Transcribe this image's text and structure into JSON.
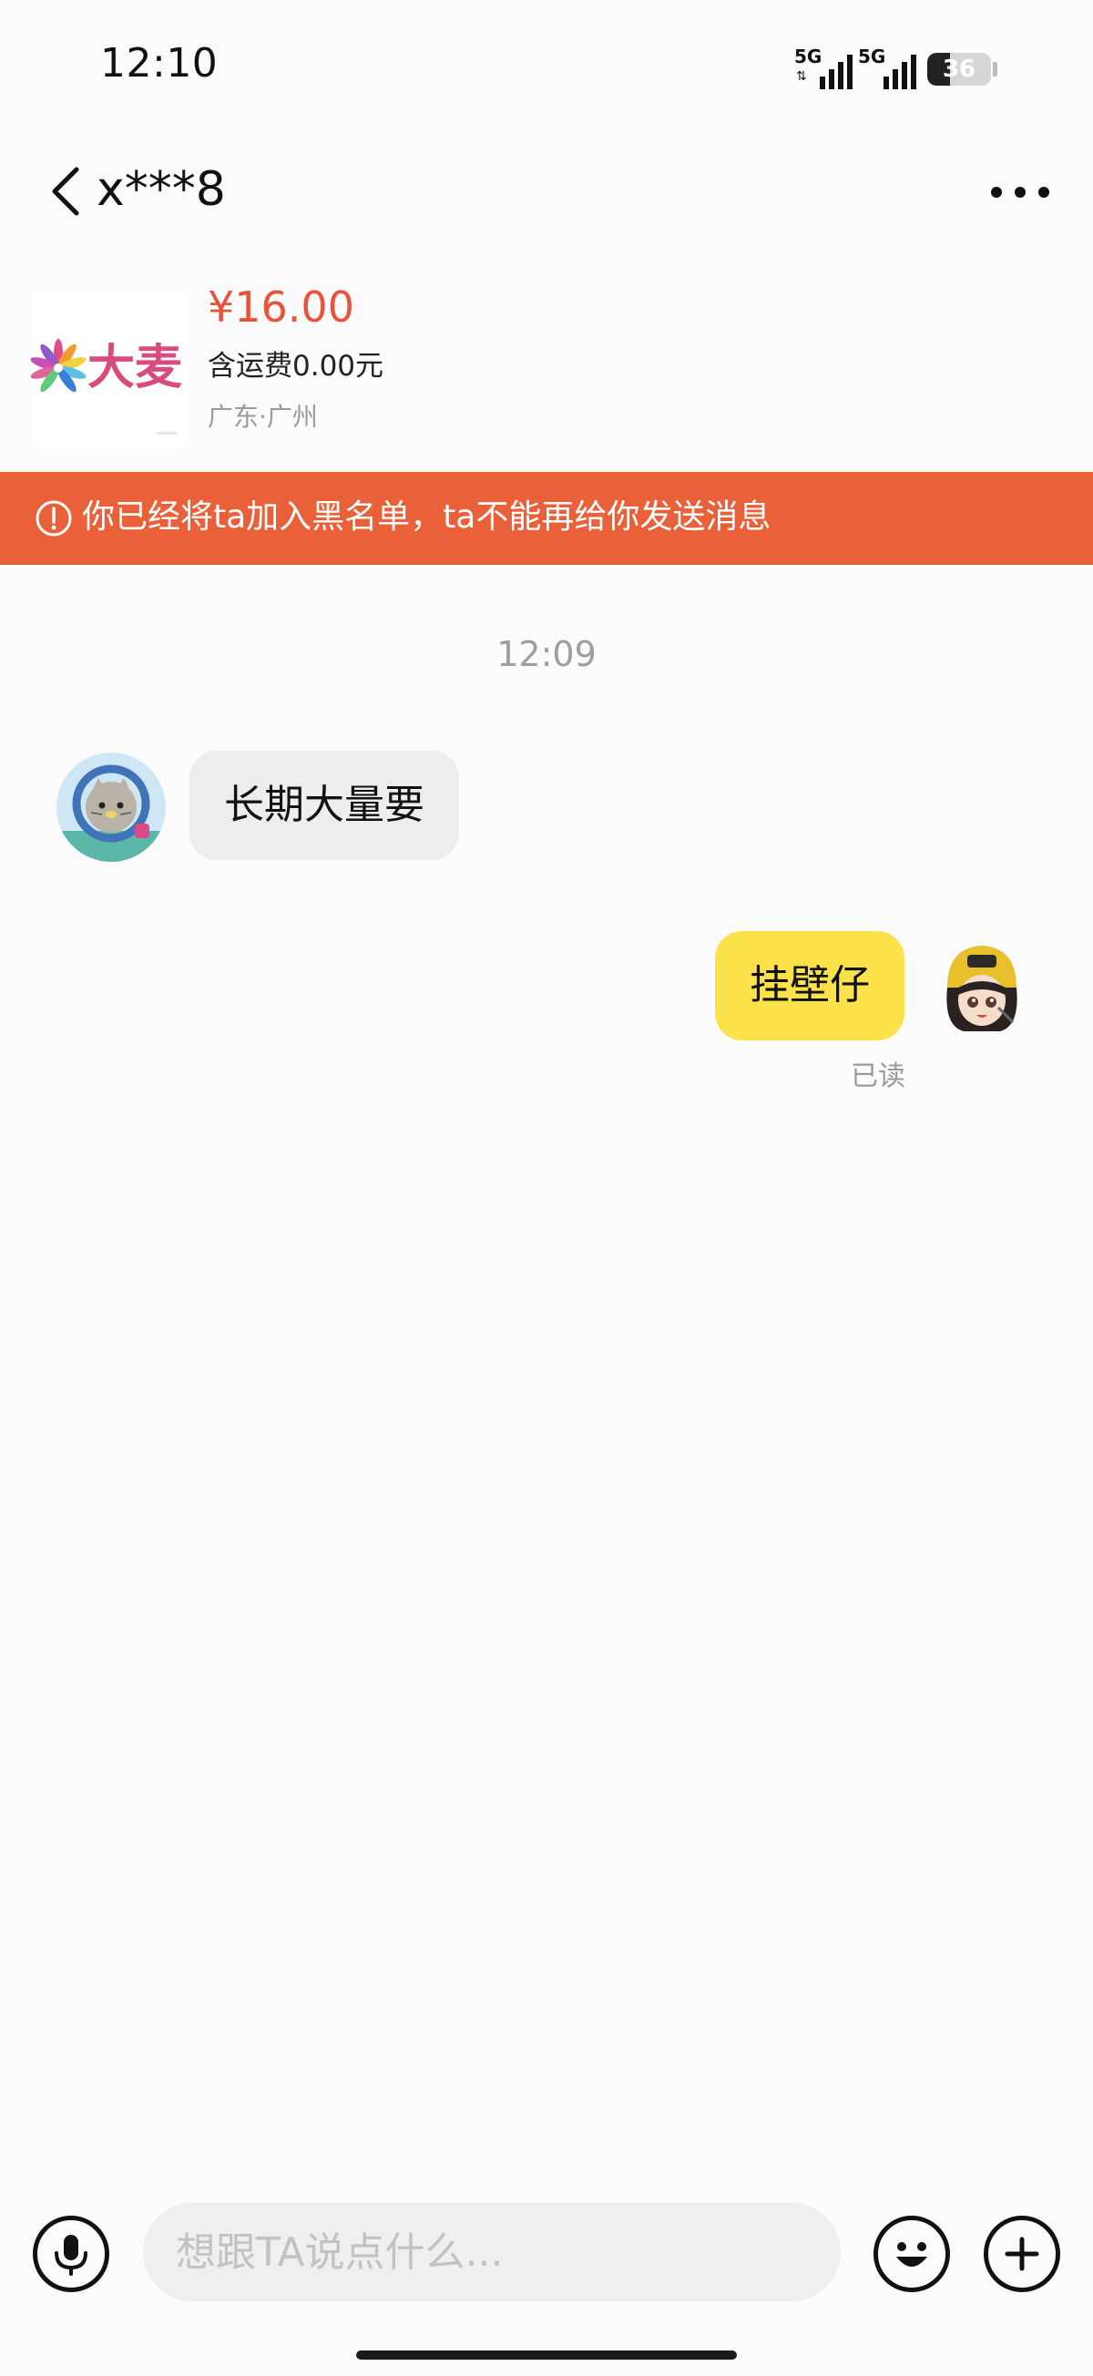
{
  "status_bar": {
    "time": "12:10",
    "network_1": "5G",
    "network_2": "5G",
    "battery_level": "36",
    "battery_fraction": 0.36
  },
  "header": {
    "title": "x***8",
    "back_icon": "chevron-left-icon",
    "menu_icon": "more-horizontal-icon"
  },
  "product": {
    "image_logo_text": "大麦",
    "price": "¥16.00",
    "shipping": "含运费0.00元",
    "location": "广东·广州"
  },
  "banner": {
    "text": "你已经将ta加入黑名单，ta不能再给你发送消息",
    "icon": "warning-circle-icon",
    "color": "#ea6039"
  },
  "chat": {
    "timestamp": "12:09",
    "messages": [
      {
        "side": "left",
        "text": "长期大量要"
      },
      {
        "side": "right",
        "text": "挂壁仔",
        "status": "已读"
      }
    ]
  },
  "input_bar": {
    "placeholder": "想跟TA说点什么...",
    "value": "",
    "voice_icon": "microphone-icon",
    "emoji_icon": "emoji-icon",
    "plus_icon": "plus-icon"
  },
  "colors": {
    "accent_price": "#e8523a",
    "sent_bubble": "#fbe24a",
    "received_bubble": "#ededed"
  }
}
